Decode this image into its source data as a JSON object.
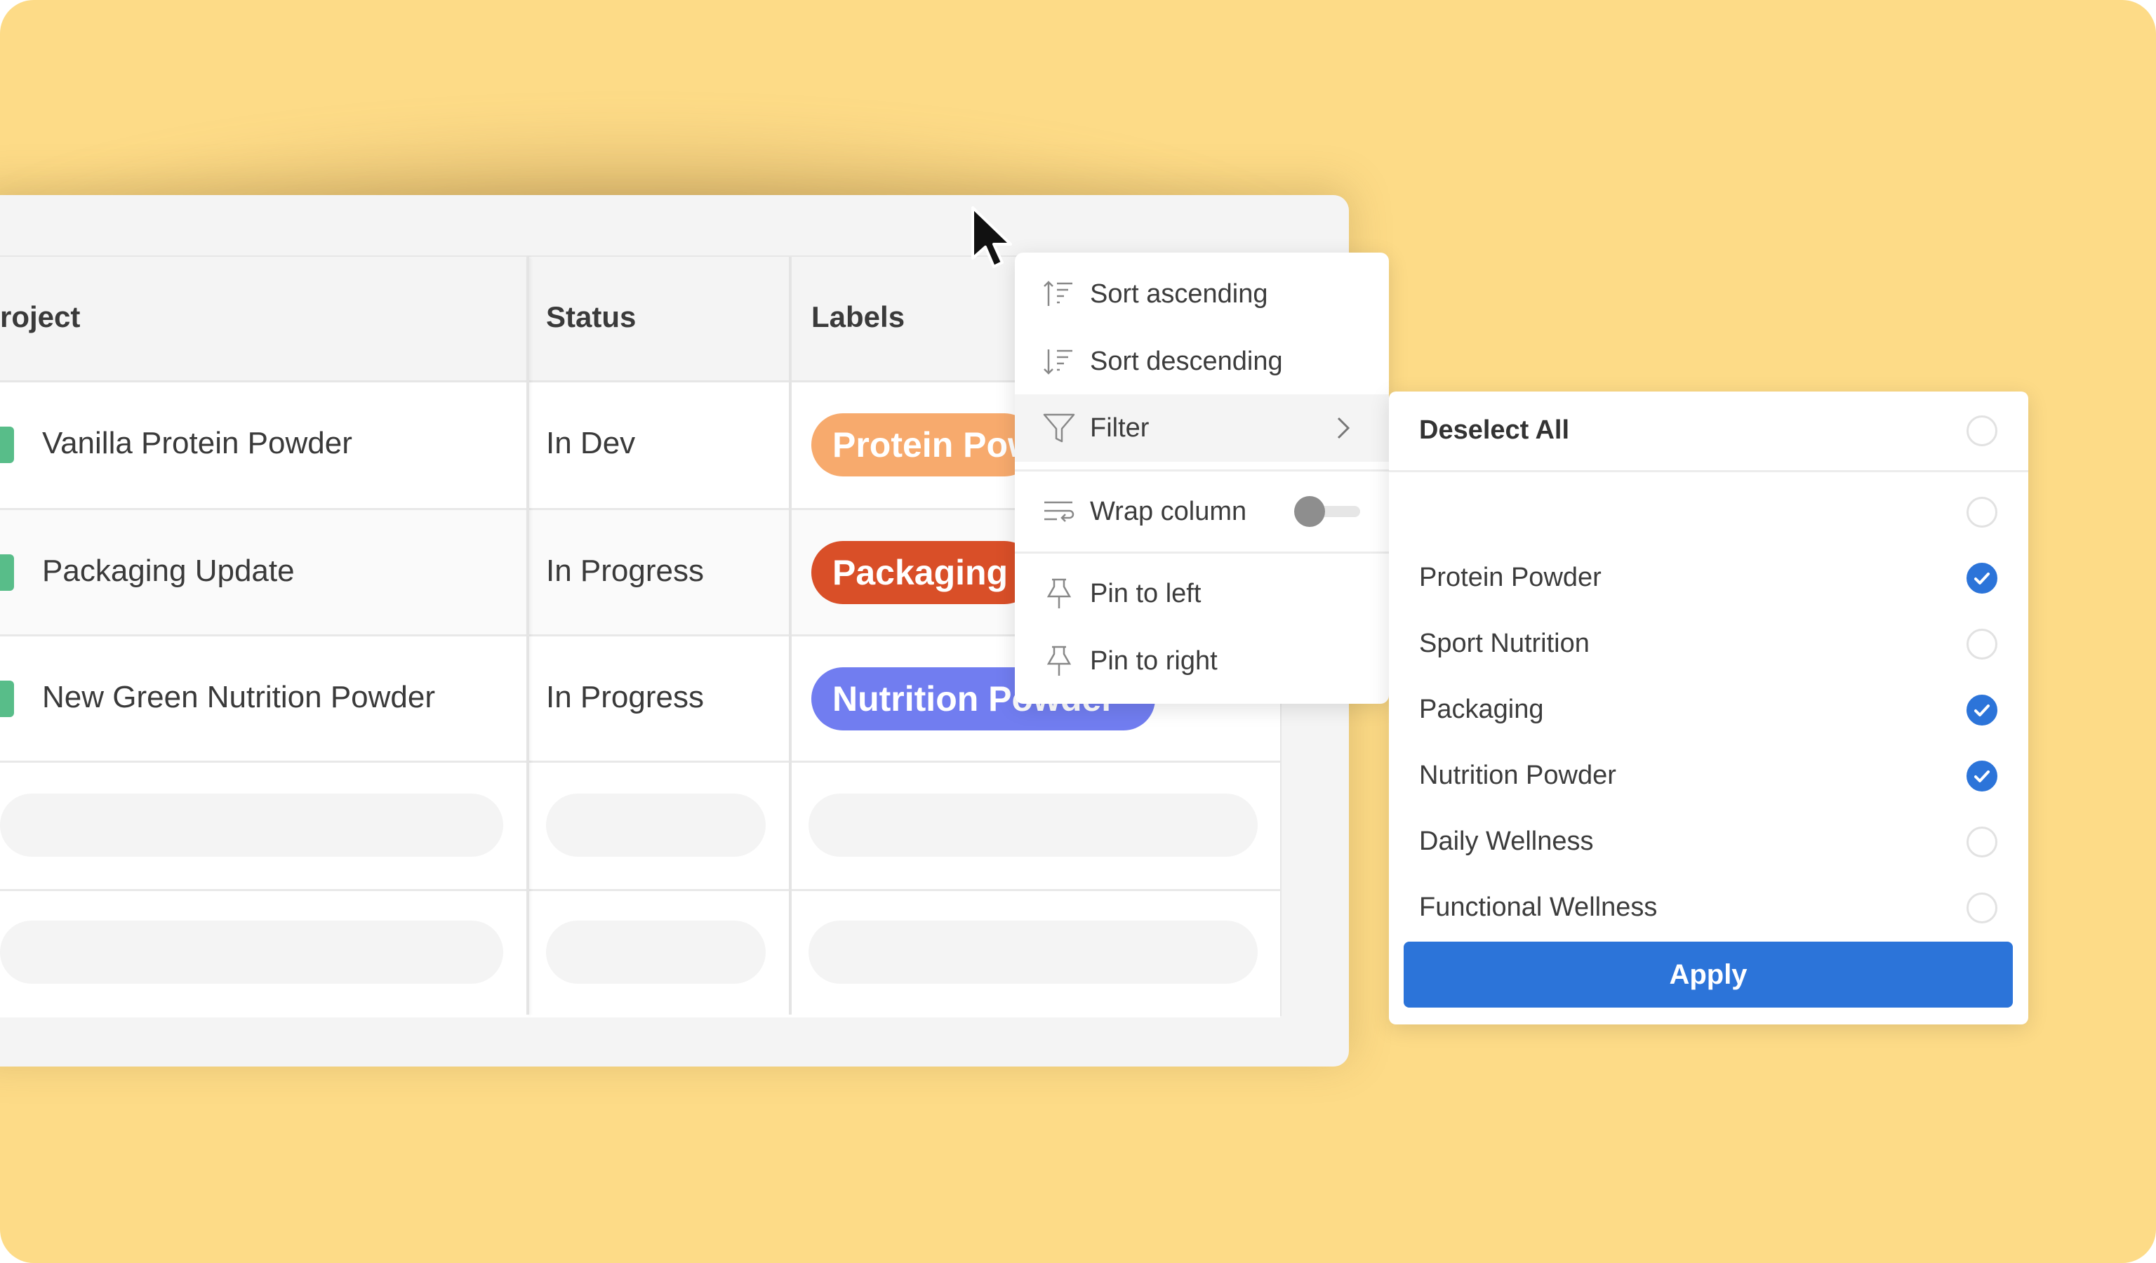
{
  "table": {
    "headers": [
      "roject",
      "Status",
      "Labels"
    ],
    "rows": [
      {
        "project": "Vanilla Protein Powder",
        "status": "In Dev",
        "label": "Protein Powder",
        "label_color": "#F7AA6D"
      },
      {
        "project": "Packaging Update",
        "status": "In Progress",
        "label": "Packaging",
        "label_color": "#D94F28"
      },
      {
        "project": "New Green Nutrition Powder",
        "status": "In Progress",
        "label": "Nutrition Powder",
        "label_color": "#717DF0"
      }
    ],
    "project_marker_color": "#58BD89"
  },
  "menu": {
    "sort_ascending": "Sort ascending",
    "sort_descending": "Sort descending",
    "filter": "Filter",
    "wrap_column": "Wrap column",
    "wrap_enabled": false,
    "pin_left": "Pin to left",
    "pin_right": "Pin to right"
  },
  "filter_panel": {
    "deselect_all": "Deselect All",
    "options": [
      {
        "label": "",
        "checked": false
      },
      {
        "label": "Protein Powder",
        "checked": true
      },
      {
        "label": "Sport Nutrition",
        "checked": false
      },
      {
        "label": "Packaging",
        "checked": true
      },
      {
        "label": "Nutrition Powder",
        "checked": true
      },
      {
        "label": "Daily Wellness",
        "checked": false
      },
      {
        "label": "Functional Wellness",
        "checked": false
      }
    ],
    "apply": "Apply",
    "accent": "#2C74D9"
  },
  "background_color": "#FDDB87"
}
